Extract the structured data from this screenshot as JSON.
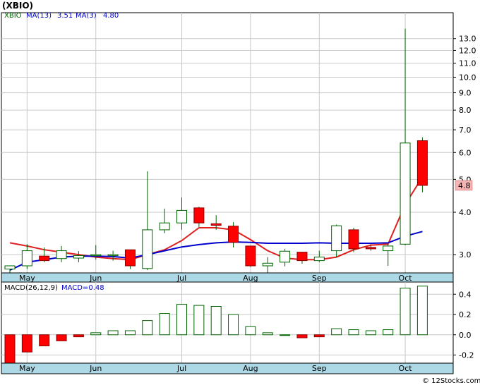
{
  "chart_data": [
    {
      "type": "candlestick",
      "title": "(XBIO)",
      "ticker": "XBIO",
      "legend": [
        {
          "label": "XBIO",
          "color": "#006400"
        },
        {
          "label": "MA(13)",
          "value": "3.51",
          "color": "#0000cc"
        },
        {
          "label": "MA(3)",
          "value": "4.80",
          "color": "#0000cc"
        }
      ],
      "y_scale": "log",
      "ylim": [
        2.65,
        15.5
      ],
      "y_ticks": [
        3.0,
        4.0,
        5.0,
        6.0,
        7.0,
        8.0,
        9.0,
        10.0,
        11.0,
        12.0,
        13.0
      ],
      "y_tick_labels": [
        "3.0",
        "4.0",
        "5.0",
        "6.0",
        "7.0",
        "8.0",
        "9.0",
        "10.0",
        "11.0",
        "12.0",
        "13.0"
      ],
      "x_labels": [
        "May",
        "Jun",
        "Jul",
        "Aug",
        "Sep",
        "Oct"
      ],
      "x_label_index": [
        1,
        5,
        10,
        14,
        18,
        23
      ],
      "last_price_label": "4.8",
      "last_price": 4.8,
      "candles": [
        {
          "o": 2.72,
          "h": 2.78,
          "l": 2.64,
          "c": 2.78
        },
        {
          "o": 2.78,
          "h": 3.22,
          "l": 2.72,
          "c": 3.08
        },
        {
          "o": 2.97,
          "h": 3.15,
          "l": 2.85,
          "c": 2.88
        },
        {
          "o": 2.92,
          "h": 3.18,
          "l": 2.85,
          "c": 3.08
        },
        {
          "o": 2.93,
          "h": 3.07,
          "l": 2.85,
          "c": 2.98
        },
        {
          "o": 2.98,
          "h": 3.2,
          "l": 2.9,
          "c": 3.0
        },
        {
          "o": 2.98,
          "h": 3.08,
          "l": 2.88,
          "c": 3.0
        },
        {
          "o": 3.1,
          "h": 3.1,
          "l": 2.72,
          "c": 2.78
        },
        {
          "o": 2.73,
          "h": 5.28,
          "l": 2.7,
          "c": 3.55
        },
        {
          "o": 3.55,
          "h": 4.1,
          "l": 3.47,
          "c": 3.72
        },
        {
          "o": 3.72,
          "h": 4.42,
          "l": 3.55,
          "c": 4.05
        },
        {
          "o": 4.12,
          "h": 4.15,
          "l": 3.62,
          "c": 3.72
        },
        {
          "o": 3.7,
          "h": 3.92,
          "l": 3.55,
          "c": 3.66
        },
        {
          "o": 3.64,
          "h": 3.74,
          "l": 3.15,
          "c": 3.26
        },
        {
          "o": 3.18,
          "h": 3.18,
          "l": 2.76,
          "c": 2.78
        },
        {
          "o": 2.78,
          "h": 2.95,
          "l": 2.65,
          "c": 2.83
        },
        {
          "o": 2.85,
          "h": 3.12,
          "l": 2.77,
          "c": 3.07
        },
        {
          "o": 3.05,
          "h": 3.05,
          "l": 2.82,
          "c": 2.88
        },
        {
          "o": 2.88,
          "h": 3.08,
          "l": 2.85,
          "c": 2.95
        },
        {
          "o": 3.08,
          "h": 3.68,
          "l": 2.95,
          "c": 3.65
        },
        {
          "o": 3.55,
          "h": 3.6,
          "l": 3.05,
          "c": 3.12
        },
        {
          "o": 3.15,
          "h": 3.22,
          "l": 3.08,
          "c": 3.12
        },
        {
          "o": 3.08,
          "h": 3.24,
          "l": 2.78,
          "c": 3.18
        },
        {
          "o": 3.22,
          "h": 13.9,
          "l": 3.2,
          "c": 6.4
        },
        {
          "o": 6.5,
          "h": 6.65,
          "l": 4.58,
          "c": 4.8
        }
      ],
      "series": [
        {
          "name": "MA(3)",
          "color": "#e02020",
          "start": 0,
          "values": [
            3.25,
            3.18,
            3.1,
            3.05,
            3.0,
            2.95,
            2.92,
            2.9,
            3.0,
            3.1,
            3.3,
            3.6,
            3.6,
            3.55,
            3.32,
            3.08,
            2.93,
            2.9,
            2.9,
            2.95,
            3.1,
            3.2,
            3.22,
            4.22,
            5.08
          ]
        },
        {
          "name": "MA(13)",
          "color": "#0000cc",
          "start": 0,
          "values": [
            2.7,
            2.85,
            2.9,
            2.95,
            2.97,
            2.97,
            2.96,
            2.93,
            3.0,
            3.08,
            3.16,
            3.21,
            3.25,
            3.27,
            3.26,
            3.24,
            3.24,
            3.24,
            3.25,
            3.24,
            3.24,
            3.24,
            3.25,
            3.4,
            3.51
          ]
        }
      ]
    },
    {
      "type": "bar",
      "title": "MACD(26,12,9)",
      "legend": [
        {
          "label": "MACD(26,12,9)",
          "color": "#000000"
        },
        {
          "label": "MACD=0.48",
          "color": "#0000cc"
        }
      ],
      "ylim": [
        -0.28,
        0.52
      ],
      "y_ticks": [
        -0.2,
        0.0,
        0.2,
        0.4
      ],
      "y_tick_labels": [
        "-0.2",
        "0.0",
        "0.2",
        "0.4"
      ],
      "x_labels": [
        "May",
        "Jun",
        "Jul",
        "Aug",
        "Sep",
        "Oct"
      ],
      "x_label_index": [
        1,
        5,
        10,
        14,
        18,
        23
      ],
      "values": [
        -0.28,
        -0.17,
        -0.11,
        -0.06,
        -0.02,
        0.02,
        0.04,
        0.04,
        0.14,
        0.21,
        0.3,
        0.29,
        0.28,
        0.2,
        0.08,
        0.02,
        0.0,
        -0.03,
        -0.02,
        0.06,
        0.05,
        0.04,
        0.05,
        0.46,
        0.48
      ]
    }
  ],
  "watermark": "© 12Stocks.com"
}
